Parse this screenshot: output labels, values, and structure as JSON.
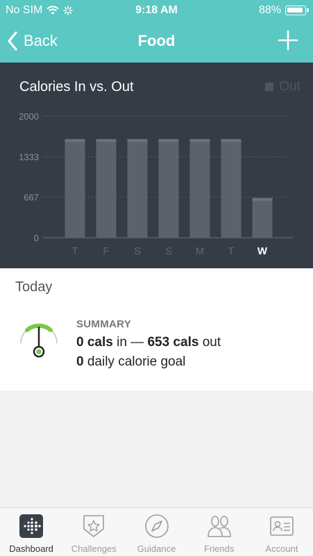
{
  "status_bar": {
    "carrier": "No SIM",
    "time": "9:18 AM",
    "battery": "88%"
  },
  "nav": {
    "back_label": "Back",
    "title": "Food"
  },
  "chart_data": {
    "type": "bar",
    "title": "Calories In vs. Out",
    "series": [
      {
        "name": "Out",
        "values": [
          1620,
          1620,
          1620,
          1620,
          1620,
          1620,
          653
        ]
      }
    ],
    "categories": [
      "T",
      "F",
      "S",
      "S",
      "M",
      "T",
      "W"
    ],
    "highlight_category_index": 6,
    "yticks": [
      "2000",
      "1333",
      "667",
      "0"
    ],
    "ylim": [
      0,
      2000
    ],
    "grid": true,
    "legend": "top-right"
  },
  "today": {
    "label": "Today",
    "summary_heading": "SUMMARY",
    "cals_in_value": "0 cals",
    "in_text": " in — ",
    "cals_out_value": "653 cals",
    "out_text": " out",
    "goal_value": "0",
    "goal_text": " daily calorie goal"
  },
  "tabs": [
    {
      "label": "Dashboard",
      "icon": "dashboard-icon",
      "active": true
    },
    {
      "label": "Challenges",
      "icon": "star-badge-icon",
      "active": false
    },
    {
      "label": "Guidance",
      "icon": "compass-icon",
      "active": false
    },
    {
      "label": "Friends",
      "icon": "friends-icon",
      "active": false
    },
    {
      "label": "Account",
      "icon": "account-card-icon",
      "active": false
    }
  ],
  "colors": {
    "header": "#5bc8c4",
    "chart_bg": "#353c45",
    "bar": "#5c626b",
    "bar_top": "#6c727b",
    "gauge_green": "#7ac943"
  }
}
